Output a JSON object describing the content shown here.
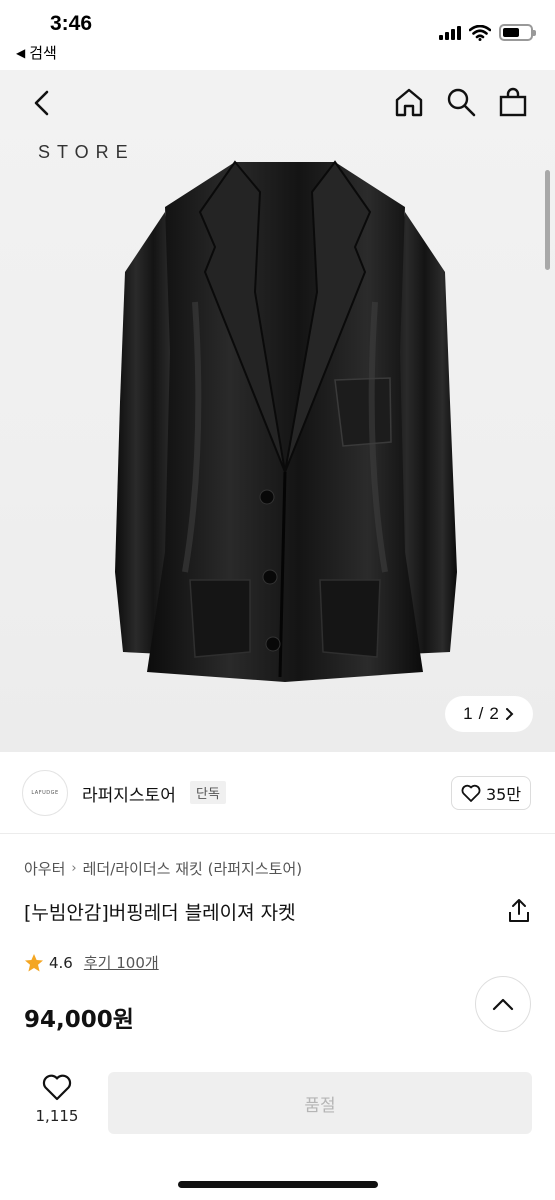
{
  "status_bar": {
    "time": "3:46",
    "back_app": "검색"
  },
  "hero": {
    "store_logo": "STORE",
    "counter_current": "1",
    "counter_sep": "/",
    "counter_total": "2",
    "background_color": "#efefef"
  },
  "nav": {
    "icons": [
      "back-icon",
      "home-icon",
      "search-icon",
      "shopping-bag-icon"
    ]
  },
  "brand": {
    "logo_text": "LAFUDGE",
    "name": "라퍼지스토어",
    "badge": "단독",
    "likes": "35만"
  },
  "product": {
    "breadcrumb": [
      "아우터",
      "레더/라이더스 재킷 (라퍼지스토어)"
    ],
    "title": "[누빔안감]버핑레더 블레이져 자켓",
    "rating": "4.6",
    "review_link": "후기 100개",
    "price": "94,000원"
  },
  "bottom": {
    "wish_count": "1,115",
    "purchase_label": "품절"
  },
  "colors": {
    "star": "#f4a623",
    "soldout_bg": "#efefef",
    "soldout_text": "#b5b5b5"
  }
}
